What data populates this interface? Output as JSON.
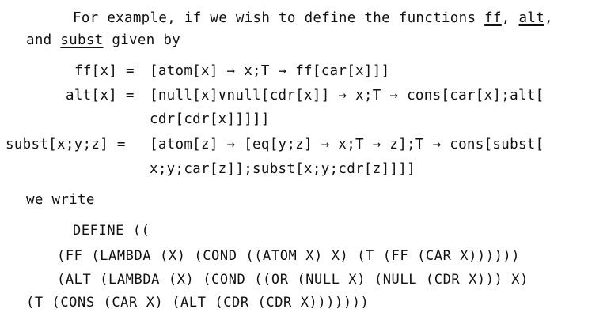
{
  "intro": {
    "part1": "For example, if we wish to define the functions ",
    "fn1": "ff",
    "sep1": ", ",
    "fn2": "alt",
    "sep2": ",",
    "part2_start": "and ",
    "fn3": "subst",
    "part2_end": " given by"
  },
  "definitions": {
    "ff_lhs": "ff[x] =",
    "ff_rhs": "[atom[x] → x;T → ff[car[x]]]",
    "alt_lhs": "alt[x] =",
    "alt_rhs1": "[null[x]∨null[cdr[x]] → x;T → cons[car[x];alt[",
    "alt_rhs2": "cdr[cdr[x]]]]]",
    "subst_lhs": "subst[x;y;z] =",
    "subst_rhs1": "[atom[z] → [eq[y;z] → x;T → z];T → cons[subst[",
    "subst_rhs2": "x;y;car[z]];subst[x;y;cdr[z]]]]"
  },
  "we_write": "we write",
  "code": {
    "line1": "DEFINE ((",
    "line2": "(FF (LAMBDA (X) (COND ((ATOM X) X) (T (FF (CAR X))))))",
    "line3": "(ALT (LAMBDA (X) (COND ((OR (NULL X) (NULL (CDR X))) X)",
    "line4": "(T (CONS (CAR X) (ALT (CDR (CDR X)))))))"
  }
}
